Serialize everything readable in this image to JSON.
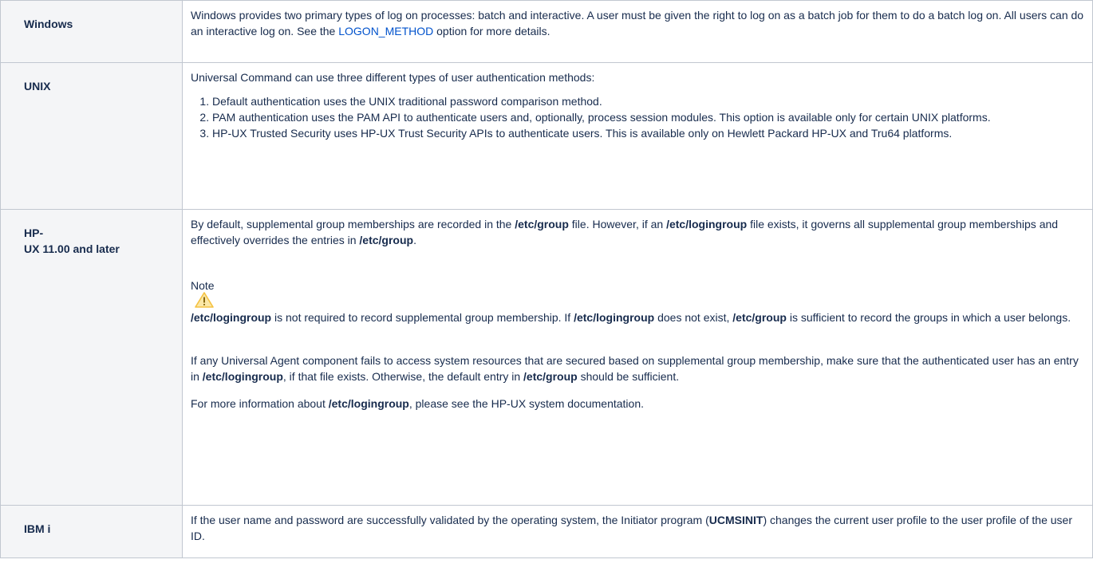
{
  "rows": [
    {
      "os": "Windows",
      "text_before": "Windows provides two primary types of log on processes: batch and interactive. A user must be given the right to log on as a batch job for them to do a batch log on. All users can do an interactive log on. See the ",
      "link": "LOGON_METHOD",
      "text_after": " option for more details."
    },
    {
      "os": "UNIX",
      "intro": "Universal Command can use three different types of user authentication methods:",
      "items": [
        "Default authentication uses the UNIX traditional password comparison method.",
        "PAM authentication uses the PAM API to authenticate users and, optionally, process session modules. This option is available only for certain UNIX platforms.",
        "HP-UX Trusted Security uses HP-UX Trust Security APIs to authenticate users. This is available only on Hewlett Packard HP-UX and Tru64 platforms."
      ]
    },
    {
      "os_line1": "HP-",
      "os_line2": "UX 11.00 and later",
      "p1": {
        "t1": "By default, supplemental group memberships are recorded in the ",
        "b1": "/etc/group",
        "t2": " file. However, if an ",
        "b2": "/etc/logingroup",
        "t3": " file exists, it governs all supplemental group memberships and effectively overrides the entries in ",
        "b3": "/etc/group",
        "t4": "."
      },
      "note_title": "Note",
      "note_icon": "warning-icon",
      "note_body": {
        "b1": "/etc/logingroup",
        "t1": " is not required to record supplemental group membership. If ",
        "b2": "/etc/logingroup",
        "t2": " does not exist, ",
        "b3": "/etc/group",
        "t3": " is sufficient to record the groups in which a user belongs."
      },
      "p2": {
        "t1": "If any Universal Agent component fails to access system resources that are secured based on supplemental group membership, make sure that the authenticated user has an entry in ",
        "b1": "/etc/logingroup",
        "t2": ", if that file exists. Otherwise, the default entry in ",
        "b2": "/etc/group",
        "t3": " should be sufficient."
      },
      "p3": {
        "t1": "For more information about ",
        "b1": "/etc/logingroup",
        "t2": ", please see the HP-UX system documentation."
      }
    },
    {
      "os": "IBM i",
      "t1": "If the user name and password are successfully validated by the operating system, the Initiator program (",
      "b1": "UCMSINIT",
      "t2": ") changes the current user profile to the user profile of the user ID."
    }
  ],
  "colors": {
    "header_bg": "#f4f5f7",
    "border": "#c1c7d0",
    "link": "#0052cc",
    "warning": "#f5c242"
  }
}
